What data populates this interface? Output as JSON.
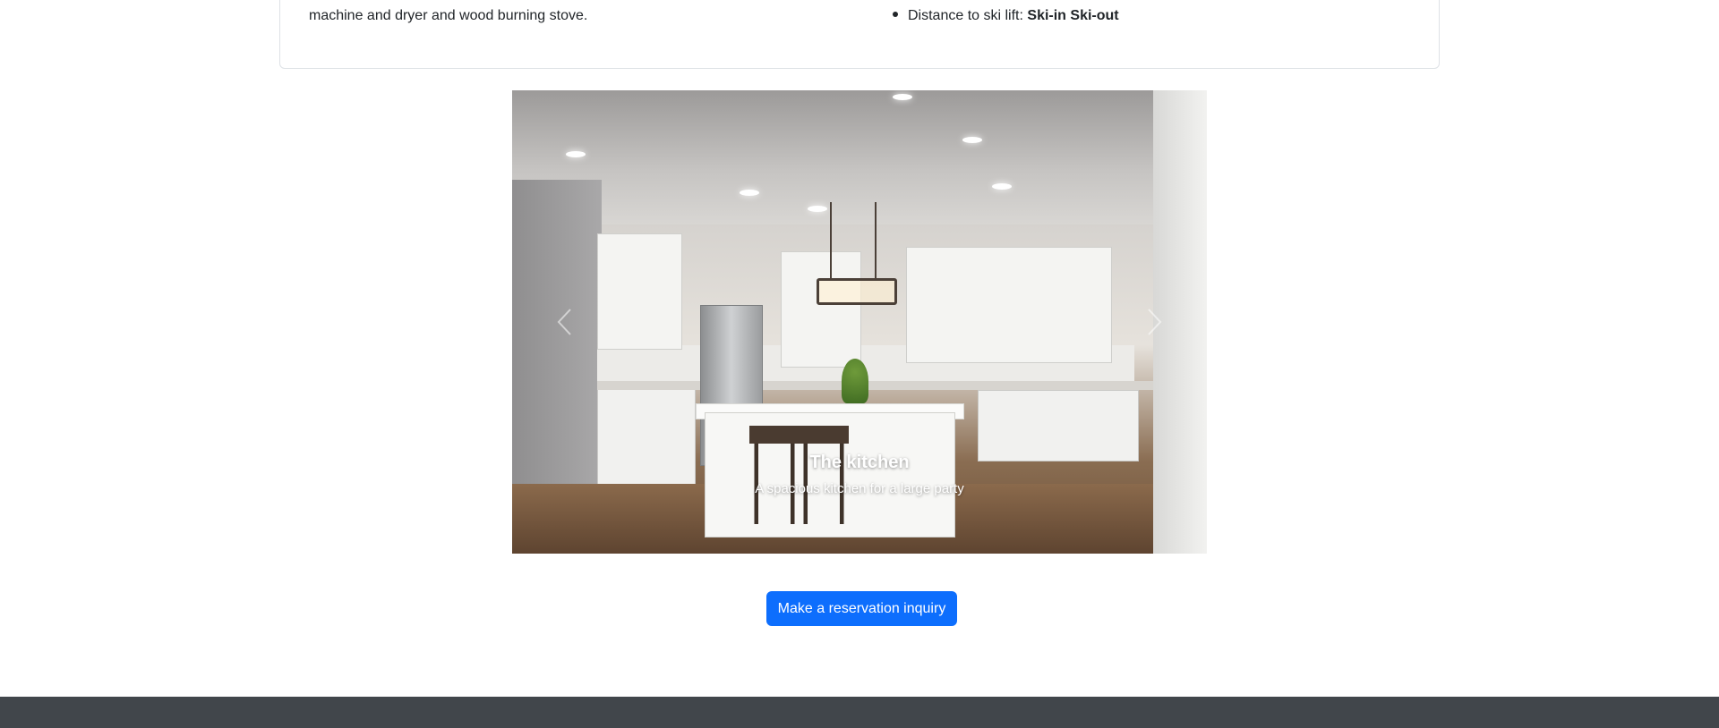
{
  "details": {
    "amenities_text": "machine and dryer and wood burning stove.",
    "ski_lift_label": "Distance to ski lift:",
    "ski_lift_value": "Ski-in Ski-out"
  },
  "carousel": {
    "slide": {
      "title": "The kitchen",
      "caption": "A spacious kitchen for a large party"
    },
    "prev_icon": "chevron-left-icon",
    "next_icon": "chevron-right-icon"
  },
  "reservation": {
    "button_label": "Make a reservation inquiry"
  },
  "colors": {
    "primary": "#0d6efd",
    "footer": "#41464b",
    "card_border": "#dee2e6"
  }
}
